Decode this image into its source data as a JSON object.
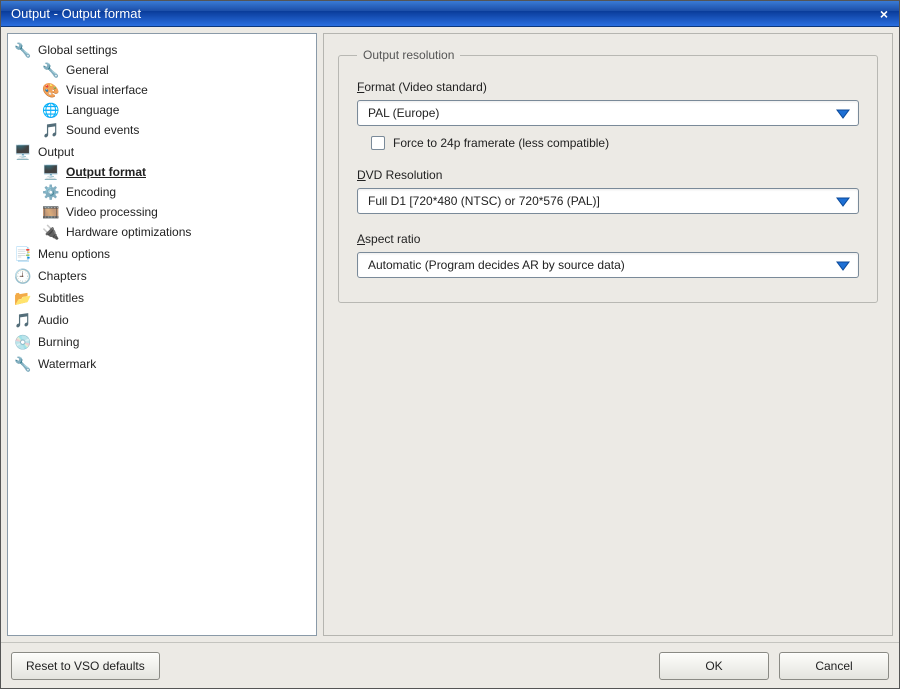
{
  "window": {
    "title": "Output - Output format",
    "close": "×"
  },
  "tree": {
    "items": [
      {
        "icon": "wrench-icon",
        "glyph": "🔧",
        "label": "Global settings",
        "children": [
          {
            "icon": "wrench-icon",
            "glyph": "🔧",
            "label": "General"
          },
          {
            "icon": "palette-icon",
            "glyph": "🎨",
            "label": "Visual interface"
          },
          {
            "icon": "globe-icon",
            "glyph": "🌐",
            "label": "Language"
          },
          {
            "icon": "sound-icon",
            "glyph": "🎵",
            "label": "Sound events"
          }
        ]
      },
      {
        "icon": "monitor-icon",
        "glyph": "🖥️",
        "label": "Output",
        "children": [
          {
            "icon": "monitor-icon",
            "glyph": "🖥️",
            "label": "Output format",
            "selected": true
          },
          {
            "icon": "gear-icon",
            "glyph": "⚙️",
            "label": "Encoding"
          },
          {
            "icon": "film-icon",
            "glyph": "🎞️",
            "label": "Video processing"
          },
          {
            "icon": "chip-icon",
            "glyph": "🔌",
            "label": "Hardware optimizations"
          }
        ]
      },
      {
        "icon": "menu-icon",
        "glyph": "📑",
        "label": "Menu options"
      },
      {
        "icon": "clock-icon",
        "glyph": "🕘",
        "label": "Chapters"
      },
      {
        "icon": "folder-icon",
        "glyph": "📂",
        "label": "Subtitles"
      },
      {
        "icon": "note-icon",
        "glyph": "🎵",
        "label": "Audio"
      },
      {
        "icon": "disc-icon",
        "glyph": "💿",
        "label": "Burning"
      },
      {
        "icon": "wrench-icon",
        "glyph": "🔧",
        "label": "Watermark"
      }
    ]
  },
  "panel": {
    "group_title": "Output resolution",
    "format": {
      "accel": "F",
      "rest": "ormat (Video standard)",
      "value": "PAL (Europe)",
      "checkbox_label": "Force to 24p framerate (less compatible)",
      "checkbox_checked": false
    },
    "dvd": {
      "accel": "D",
      "rest": "VD Resolution",
      "value": "Full D1 [720*480 (NTSC) or 720*576 (PAL)]"
    },
    "aspect": {
      "accel": "A",
      "rest": "spect ratio",
      "value": "Automatic (Program decides AR by source data)"
    }
  },
  "buttons": {
    "reset": "Reset to VSO defaults",
    "ok": "OK",
    "cancel": "Cancel"
  }
}
